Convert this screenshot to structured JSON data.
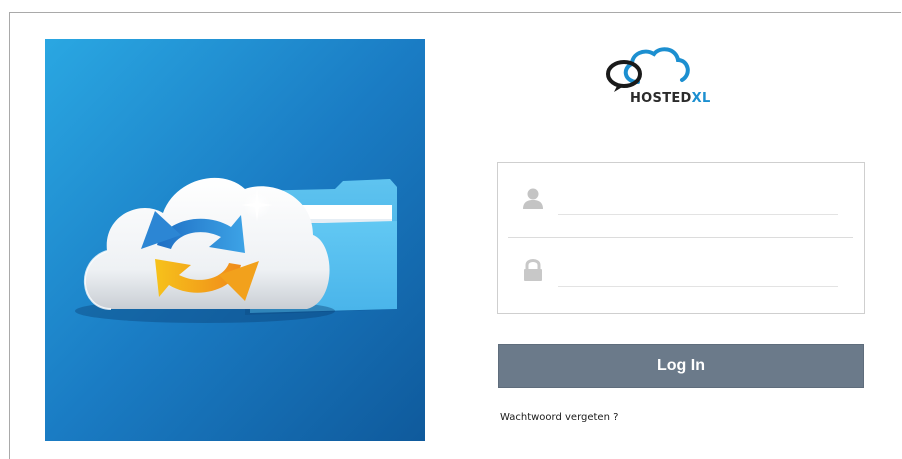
{
  "brand": {
    "name_main": "HOSTED",
    "name_accent": "XL",
    "accent_color": "#1c8fd0"
  },
  "hero": {
    "icon": "cloud-sync-folder-illustration",
    "background_color": "#1565a8"
  },
  "login": {
    "username_icon": "user-icon",
    "username_value": "",
    "username_placeholder": "",
    "password_icon": "lock-icon",
    "password_value": "",
    "password_placeholder": "",
    "submit_label": "Log In",
    "submit_color": "#6b7a8a",
    "forgot_label": "Wachtwoord vergeten ?"
  }
}
